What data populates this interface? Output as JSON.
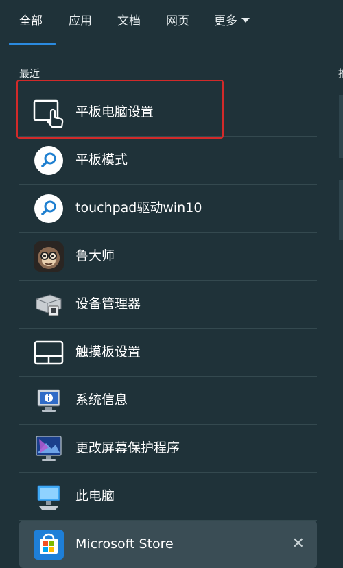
{
  "tabs": [
    {
      "label": "全部",
      "active": true
    },
    {
      "label": "应用"
    },
    {
      "label": "文档"
    },
    {
      "label": "网页"
    },
    {
      "label": "更多"
    }
  ],
  "section_title": "最近",
  "right_stub": "推",
  "items": [
    {
      "label": "平板电脑设置",
      "icon": "tablet-touch-icon"
    },
    {
      "label": "平板模式",
      "icon": "search-icon"
    },
    {
      "label": "touchpad驱动win10",
      "icon": "search-icon"
    },
    {
      "label": "鲁大师",
      "icon": "ludashi-monkey-icon"
    },
    {
      "label": "设备管理器",
      "icon": "device-manager-icon"
    },
    {
      "label": "触摸板设置",
      "icon": "touchpad-icon"
    },
    {
      "label": "系统信息",
      "icon": "system-info-icon"
    },
    {
      "label": "更改屏幕保护程序",
      "icon": "screensaver-icon"
    },
    {
      "label": "此电脑",
      "icon": "this-pc-icon"
    },
    {
      "label": "Microsoft Store",
      "icon": "microsoft-store-icon"
    }
  ],
  "colors": {
    "accent": "#2b8be0",
    "highlight": "#d12a2a",
    "background": "#1f3239"
  }
}
